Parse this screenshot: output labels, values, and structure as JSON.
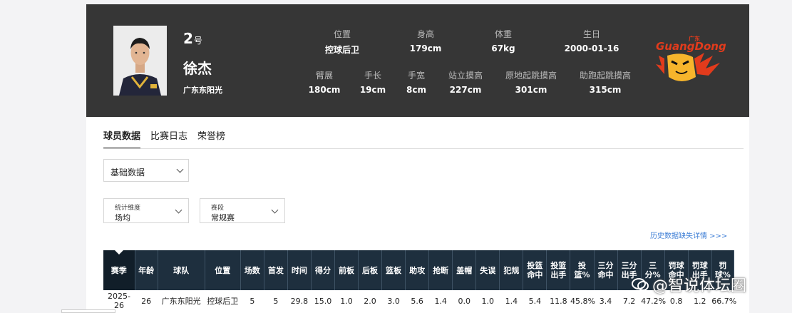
{
  "player": {
    "number": "2",
    "number_suffix": "号",
    "name": "徐杰",
    "team": "广东东阳光"
  },
  "attributes": [
    {
      "label": "位置",
      "value": "控球后卫"
    },
    {
      "label": "身高",
      "value": "179cm"
    },
    {
      "label": "体重",
      "value": "67kg"
    },
    {
      "label": "生日",
      "value": "2000-01-16"
    },
    {
      "label": "臂展",
      "value": "180cm"
    },
    {
      "label": "手长",
      "value": "19cm"
    },
    {
      "label": "手宽",
      "value": "8cm"
    },
    {
      "label": "站立摸高",
      "value": "227cm"
    },
    {
      "label": "原地起跳摸高",
      "value": "301cm"
    },
    {
      "label": "助跑起跳摸高",
      "value": "315cm"
    }
  ],
  "team_logo": {
    "top_text": "广东",
    "word": "GuangDong",
    "colors": {
      "primary": "#e23b1c",
      "accent": "#f7b52c"
    }
  },
  "tabs": [
    {
      "label": "球员数据",
      "active": true
    },
    {
      "label": "比赛日志",
      "active": false
    },
    {
      "label": "荣誉榜",
      "active": false
    }
  ],
  "filters": {
    "main_select": "基础数据",
    "dimension": {
      "label": "统计维度",
      "value": "场均"
    },
    "stage": {
      "label": "赛段",
      "value": "常规赛"
    }
  },
  "history_link": "历史数据缺失详情 >>>",
  "table": {
    "headers": [
      "赛季",
      "年龄",
      "球队",
      "位置",
      "场数",
      "首发",
      "时间",
      "得分",
      "前板",
      "后板",
      "篮板",
      "助攻",
      "抢断",
      "盖帽",
      "失误",
      "犯规",
      "投篮命中",
      "投篮出手",
      "投篮%",
      "三分命中",
      "三分出手",
      "三分%",
      "罚球命中",
      "罚球出手",
      "罚球%"
    ],
    "rows": [
      [
        "2025-26",
        "26",
        "广东东阳光",
        "控球后卫",
        "5",
        "5",
        "29.8",
        "15.0",
        "1.0",
        "2.0",
        "3.0",
        "5.6",
        "1.4",
        "0.0",
        "1.0",
        "1.4",
        "5.4",
        "11.8",
        "45.8%",
        "3.4",
        "7.2",
        "47.2%",
        "0.8",
        "1.2",
        "66.7%"
      ]
    ]
  },
  "watermark": "@智说体坛圈",
  "colors": {
    "header_bg": "#363636",
    "table_header_bg": "#1e2f3e",
    "link": "#3f7fd6"
  }
}
